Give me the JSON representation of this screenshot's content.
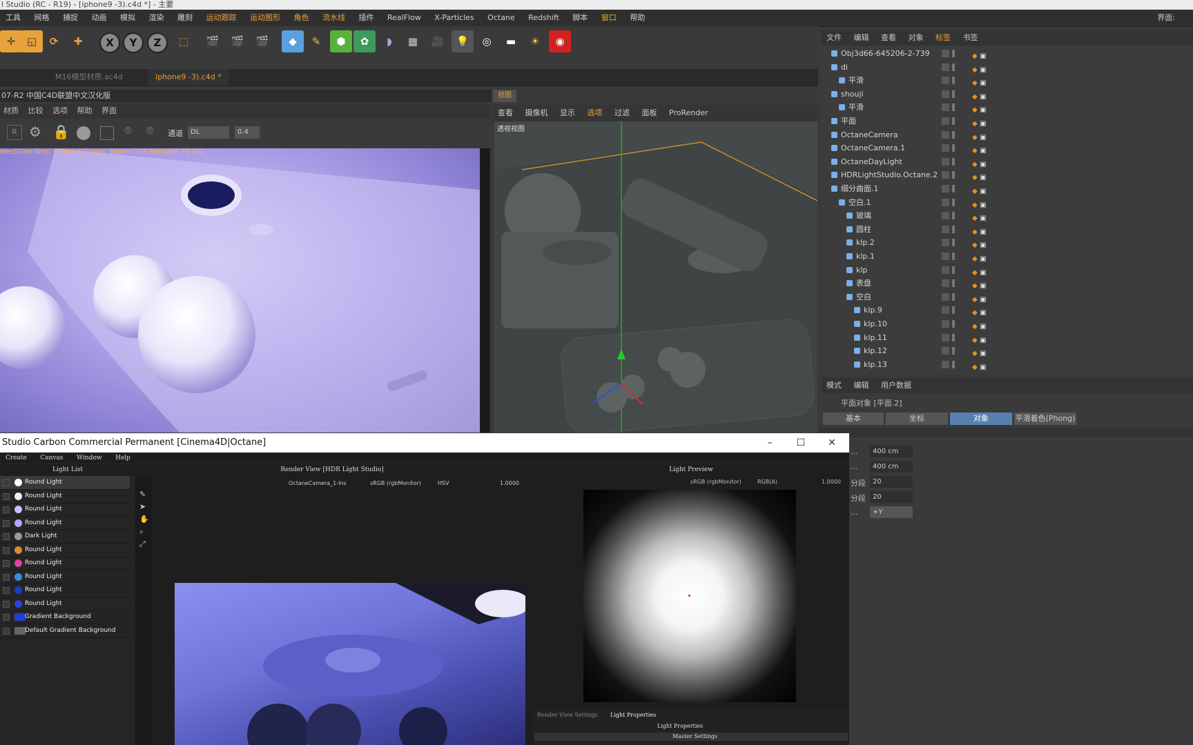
{
  "window_title": "l Studio (RC - R19) - [iphone9 -3).c4d *] - 主要",
  "menu": [
    "工具",
    "网格",
    "捕捉",
    "动画",
    "模拟",
    "渲染",
    "雕刻",
    "运动跟踪",
    "运动图形",
    "角色",
    "流水线",
    "插件",
    "RealFlow",
    "X-Particles",
    "Octane",
    "Redshift",
    "脚本",
    "窗口",
    "帮助"
  ],
  "menu_right": "界面:",
  "toolbar": {
    "x": "X",
    "y": "Y",
    "z": "Z"
  },
  "doc_tabs": [
    "M16模型材质.ac4d",
    "iphone9 -3).c4d *"
  ],
  "left_panel": {
    "title": "07-R2 中国C4D联盟中文汉化版",
    "menu": [
      "材质",
      "比较",
      "选项",
      "帮助",
      "界面"
    ],
    "channel_label": "通道",
    "channel_value": "DL",
    "value": "0.4",
    "status": "MeshGen:0ms, Update[C]:0ms, Nodes:228 Movable:76  0 0"
  },
  "viewport": {
    "tab": "视图",
    "menu": [
      "查看",
      "摄像机",
      "显示",
      "选项",
      "过滤",
      "面板",
      "ProRender"
    ],
    "label": "透视视图"
  },
  "object_manager": {
    "menu": [
      "文件",
      "编辑",
      "查看",
      "对象",
      "标签",
      "书签"
    ],
    "rows": [
      {
        "name": "Obj3d66-645206-2-739",
        "indent": 0
      },
      {
        "name": "di",
        "indent": 0
      },
      {
        "name": "平滑",
        "indent": 1
      },
      {
        "name": "shouji",
        "indent": 0
      },
      {
        "name": "平滑",
        "indent": 1
      },
      {
        "name": "平面",
        "indent": 0
      },
      {
        "name": "OctaneCamera",
        "indent": 0
      },
      {
        "name": "OctaneCamera.1",
        "indent": 0
      },
      {
        "name": "OctaneDayLight",
        "indent": 0
      },
      {
        "name": "HDRLightStudio.Octane.2",
        "indent": 0
      },
      {
        "name": "细分曲面.1",
        "indent": 0
      },
      {
        "name": "空白.1",
        "indent": 1
      },
      {
        "name": "玻璃",
        "indent": 2
      },
      {
        "name": "圆柱",
        "indent": 2
      },
      {
        "name": "klp.2",
        "indent": 2
      },
      {
        "name": "klp.1",
        "indent": 2
      },
      {
        "name": "klp",
        "indent": 2
      },
      {
        "name": "表盘",
        "indent": 2
      },
      {
        "name": "空白",
        "indent": 2
      },
      {
        "name": "klp.9",
        "indent": 3
      },
      {
        "name": "klp.10",
        "indent": 3
      },
      {
        "name": "klp.11",
        "indent": 3
      },
      {
        "name": "klp.12",
        "indent": 3
      },
      {
        "name": "klp.13",
        "indent": 3
      }
    ]
  },
  "attribute_manager": {
    "menu": [
      "模式",
      "编辑",
      "用户数据"
    ],
    "title": "平面对象 [平面.2]",
    "tabs": [
      "基本",
      "坐标",
      "对象",
      "平滑着色(Phong)"
    ],
    "fields": [
      {
        "label": "...",
        "value": "400 cm"
      },
      {
        "label": "...",
        "value": "400 cm"
      },
      {
        "label": "分段",
        "value": "20"
      },
      {
        "label": "分段",
        "value": "20"
      },
      {
        "label": "...",
        "value": "+Y"
      }
    ]
  },
  "hdr": {
    "title": "Studio Carbon Commercial Permanent [Cinema4D|Octane]",
    "menu": [
      "Create",
      "Canvas",
      "Window",
      "Help"
    ],
    "light_list_title": "Light List",
    "lights": [
      {
        "name": "Round Light",
        "color": "#ffffff"
      },
      {
        "name": "Round Light",
        "color": "#f0f0f0"
      },
      {
        "name": "Round Light",
        "color": "#c0c4ff"
      },
      {
        "name": "Round Light",
        "color": "#b0a8ff"
      },
      {
        "name": "Dark Light",
        "color": "#9a9a9a"
      },
      {
        "name": "Round Light",
        "color": "#e08a2c"
      },
      {
        "name": "Round Light",
        "color": "#e040a0"
      },
      {
        "name": "Round Light",
        "color": "#3a8ae0"
      },
      {
        "name": "Round Light",
        "color": "#1a40c0"
      },
      {
        "name": "Round Light",
        "color": "#3040e0"
      },
      {
        "name": "Gradient Background",
        "color": "#2040d0"
      },
      {
        "name": "Default Gradient Background",
        "color": "#666666"
      }
    ],
    "render_view_title": "Render View [HDR Light Studio]",
    "camera": "OctaneCamera_1-Ins",
    "colorspace": "sRGB (rgbMonitor)",
    "channel": "HSV",
    "exposure": "1.0000",
    "light_preview_title": "Light Preview",
    "lp_colorspace": "sRGB (rgbMonitor)",
    "lp_channel": "RGB(A)",
    "lp_exposure": "1.0000",
    "bottom_tabs": [
      "Render View Settings",
      "Light Properties"
    ],
    "light_properties": "Light Properties",
    "master_settings": "Master Settings"
  }
}
